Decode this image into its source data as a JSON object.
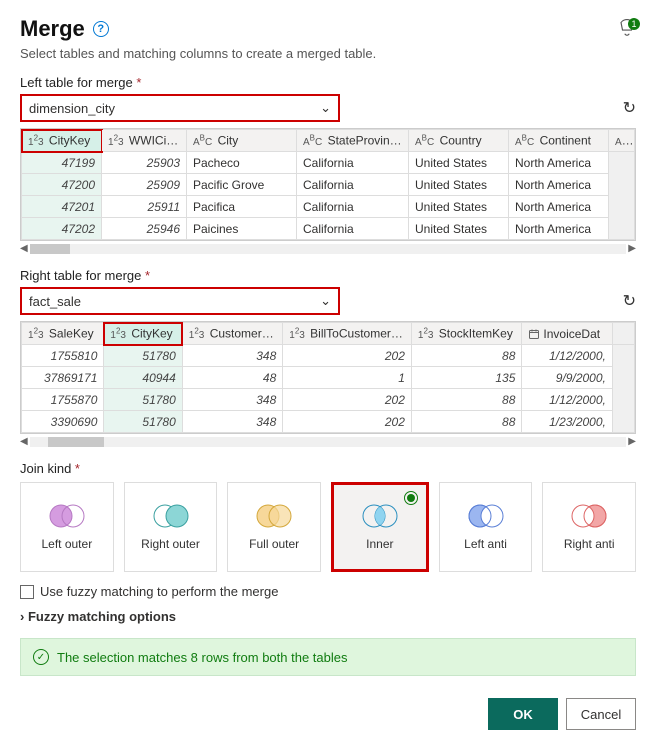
{
  "header": {
    "title": "Merge",
    "notification_count": "1"
  },
  "subtitle": "Select tables and matching columns to create a merged table.",
  "left": {
    "label": "Left table for merge",
    "selected": "dimension_city",
    "columns": [
      "CityKey",
      "WWICityID",
      "City",
      "StateProvince",
      "Country",
      "Continent"
    ],
    "col_types": [
      "num",
      "num",
      "text",
      "text",
      "text",
      "text"
    ],
    "selected_col_index": 0,
    "rows": [
      [
        "47199",
        "25903",
        "Pacheco",
        "California",
        "United States",
        "North America"
      ],
      [
        "47200",
        "25909",
        "Pacific Grove",
        "California",
        "United States",
        "North America"
      ],
      [
        "47201",
        "25911",
        "Pacifica",
        "California",
        "United States",
        "North America"
      ],
      [
        "47202",
        "25946",
        "Paicines",
        "California",
        "United States",
        "North America"
      ]
    ]
  },
  "right": {
    "label": "Right table for merge",
    "selected": "fact_sale",
    "columns": [
      "SaleKey",
      "CityKey",
      "CustomerKey",
      "BillToCustomerKey",
      "StockItemKey",
      "InvoiceDat"
    ],
    "col_types": [
      "num",
      "num",
      "num",
      "num",
      "num",
      "date"
    ],
    "selected_col_index": 1,
    "rows": [
      [
        "1755810",
        "51780",
        "348",
        "202",
        "88",
        "1/12/2000,"
      ],
      [
        "37869171",
        "40944",
        "48",
        "1",
        "135",
        "9/9/2000,"
      ],
      [
        "1755870",
        "51780",
        "348",
        "202",
        "88",
        "1/12/2000,"
      ],
      [
        "3390690",
        "51780",
        "348",
        "202",
        "88",
        "1/23/2000,"
      ]
    ]
  },
  "join": {
    "label": "Join kind",
    "options": [
      "Left outer",
      "Right outer",
      "Full outer",
      "Inner",
      "Left anti",
      "Right anti"
    ],
    "selected_index": 3
  },
  "fuzzy_checkbox": "Use fuzzy matching to perform the merge",
  "fuzzy_expander": "Fuzzy matching options",
  "success_msg": "The selection matches 8 rows from both the tables",
  "buttons": {
    "ok": "OK",
    "cancel": "Cancel"
  }
}
